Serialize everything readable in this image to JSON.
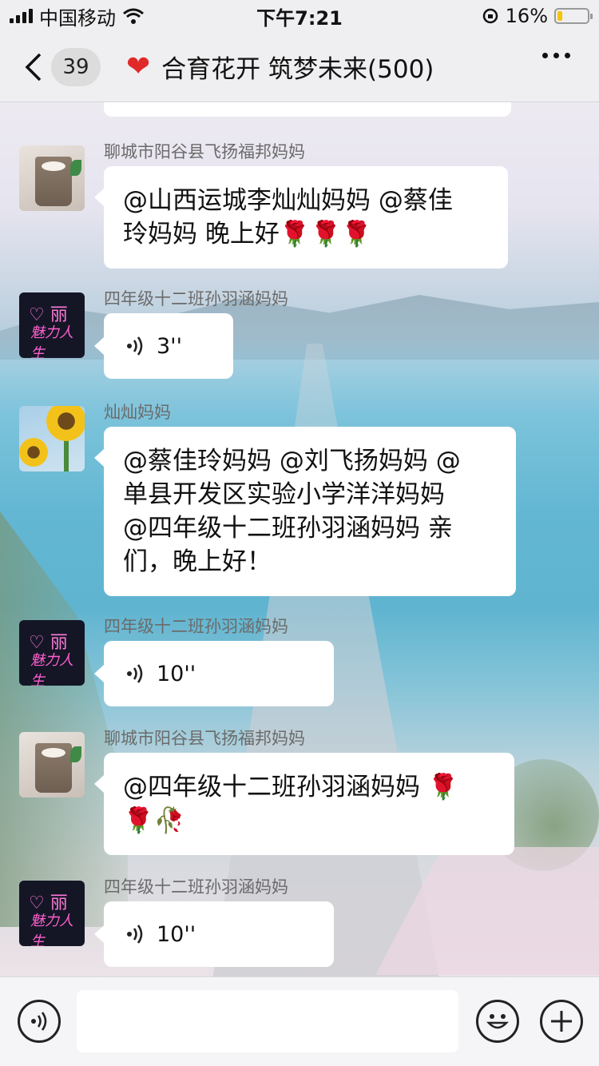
{
  "status_bar": {
    "carrier": "中国移动",
    "time": "下午7:21",
    "battery_percent": "16%",
    "battery_level": 0.16
  },
  "nav": {
    "unread_count": "39",
    "title": "合育花开 筑梦未来(500)"
  },
  "messages": [
    {
      "sender": "聊城市阳谷县飞扬福邦妈妈",
      "type": "text",
      "lines": [
        "@山西运城李灿灿妈妈 @蔡佳",
        "玲妈妈 晚上好🌹🌹🌹"
      ],
      "avatar": "milk-tea-avatar"
    },
    {
      "sender": "四年级十二班孙羽涵妈妈",
      "type": "voice",
      "duration": "3''",
      "avatar": "neon-avatar"
    },
    {
      "sender": "灿灿妈妈",
      "type": "text",
      "lines": [
        "@蔡佳玲妈妈 @刘飞扬妈妈 @",
        "单县开发区实验小学洋洋妈妈",
        "@四年级十二班孙羽涵妈妈  亲",
        "们，晚上好！"
      ],
      "avatar": "sunflower-avatar"
    },
    {
      "sender": "四年级十二班孙羽涵妈妈",
      "type": "voice",
      "duration": "10''",
      "avatar": "neon-avatar"
    },
    {
      "sender": "聊城市阳谷县飞扬福邦妈妈",
      "type": "text",
      "lines": [
        "@四年级十二班孙羽涵妈妈 🌹",
        "🌹🥀"
      ],
      "avatar": "milk-tea-avatar"
    },
    {
      "sender": "四年级十二班孙羽涵妈妈",
      "type": "voice",
      "duration": "10''",
      "avatar": "neon-avatar"
    }
  ],
  "neon_avatar_text": {
    "line1": "♡ 丽",
    "line2": "魅力人生"
  },
  "input": {
    "placeholder": ""
  },
  "colors": {
    "bubble": "#ffffff",
    "heart": "#e02a2a",
    "battery": "#f5c400"
  }
}
